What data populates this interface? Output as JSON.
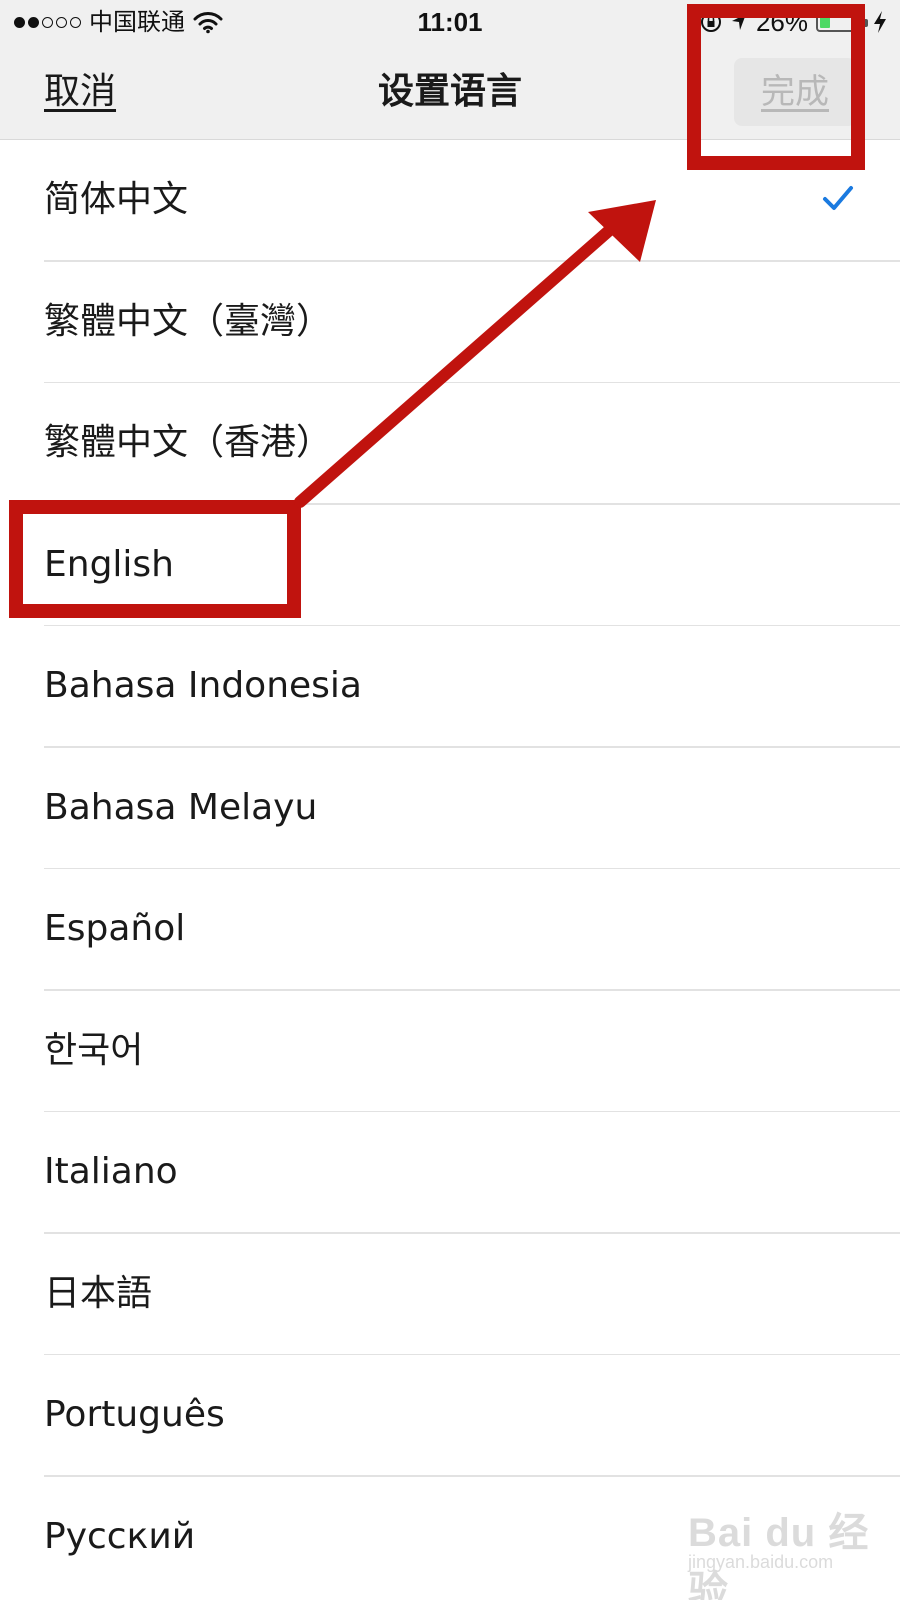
{
  "status_bar": {
    "signal_dots": [
      true,
      true,
      false,
      false,
      false
    ],
    "carrier": "中国联通",
    "wifi_icon": "wifi-icon",
    "time": "11:01",
    "battery_percent": "26%",
    "battery_level": 0.26,
    "battery_fill_color": "#4cd964"
  },
  "nav": {
    "cancel_label": "取消",
    "title": "设置语言",
    "done_label": "完成",
    "done_enabled": false
  },
  "languages": [
    {
      "label": "简体中文",
      "selected": true
    },
    {
      "label": "繁體中文（臺灣）",
      "selected": false
    },
    {
      "label": "繁體中文（香港）",
      "selected": false
    },
    {
      "label": "English",
      "selected": false
    },
    {
      "label": "Bahasa Indonesia",
      "selected": false
    },
    {
      "label": "Bahasa Melayu",
      "selected": false
    },
    {
      "label": "Español",
      "selected": false
    },
    {
      "label": "한국어",
      "selected": false
    },
    {
      "label": "Italiano",
      "selected": false
    },
    {
      "label": "日本語",
      "selected": false
    },
    {
      "label": "Português",
      "selected": false
    },
    {
      "label": "Русский",
      "selected": false
    }
  ],
  "colors": {
    "checkmark": "#1a7ae0",
    "annotation": "#c0130e",
    "bar_background": "#f0f0f0"
  },
  "watermark": {
    "brand": "Bai du 经验",
    "url": "jingyan.baidu.com"
  }
}
